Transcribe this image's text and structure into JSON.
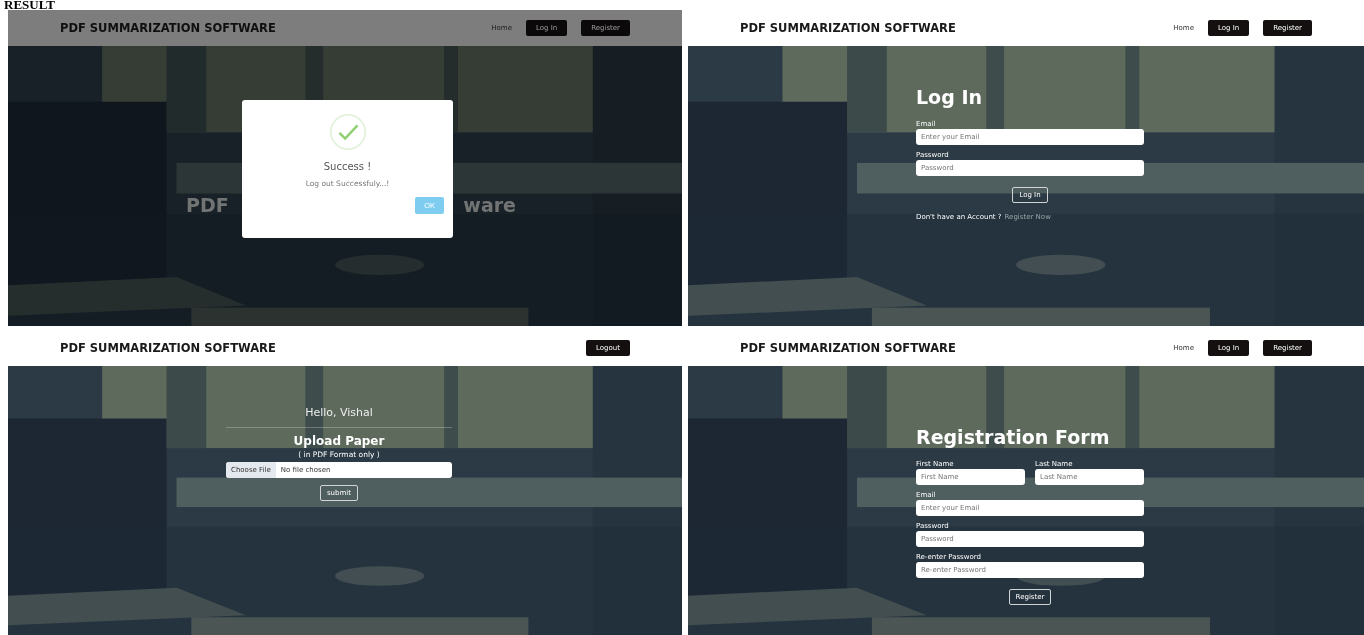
{
  "heading": "RESULT",
  "panels": [
    {
      "kind": "modal",
      "brand": "PDF SUMMARIZATION SOFTWARE",
      "dimmed": true,
      "nav": [
        {
          "label": "Home",
          "kind": "link"
        },
        {
          "label": "Log In",
          "kind": "button"
        },
        {
          "label": "Register",
          "kind": "button"
        }
      ],
      "hero_left": "PDF",
      "hero_right": "ware",
      "dialog": {
        "title": "Success !",
        "message": "Log out Successfuly...!",
        "button": "OK"
      }
    },
    {
      "kind": "login",
      "brand": "PDF SUMMARIZATION SOFTWARE",
      "dimmed": false,
      "nav": [
        {
          "label": "Home",
          "kind": "link"
        },
        {
          "label": "Log In",
          "kind": "button"
        },
        {
          "label": "Register",
          "kind": "button"
        }
      ],
      "title": "Log In",
      "rows": [
        [
          {
            "label": "Email",
            "placeholder": "Enter your Email"
          }
        ],
        [
          {
            "label": "Password",
            "placeholder": "Password"
          }
        ]
      ],
      "button": "Log In",
      "footer": "Don't have an Account ?",
      "link": "Register Now"
    },
    {
      "kind": "upload",
      "brand": "PDF SUMMARIZATION SOFTWARE",
      "dimmed": false,
      "nav": [
        {
          "label": "Logout",
          "kind": "button"
        }
      ],
      "greeting": "Hello, Vishal",
      "title": "Upload Paper",
      "subtitle": "( in PDF Format only )",
      "file_button": "Choose File",
      "file_status": "No file chosen",
      "button": "submit"
    },
    {
      "kind": "register",
      "brand": "PDF SUMMARIZATION SOFTWARE",
      "dimmed": false,
      "nav": [
        {
          "label": "Home",
          "kind": "link"
        },
        {
          "label": "Log In",
          "kind": "button"
        },
        {
          "label": "Register",
          "kind": "button"
        }
      ],
      "title": "Registration Form",
      "rows": [
        [
          {
            "label": "First Name",
            "placeholder": "First Name"
          },
          {
            "label": "Last Name",
            "placeholder": "Last Name"
          }
        ],
        [
          {
            "label": "Email",
            "placeholder": "Enter your Email"
          }
        ],
        [
          {
            "label": "Password",
            "placeholder": "Password"
          }
        ],
        [
          {
            "label": "Re-enter Password",
            "placeholder": "Re-enter Password"
          }
        ]
      ],
      "button": "Register"
    }
  ]
}
